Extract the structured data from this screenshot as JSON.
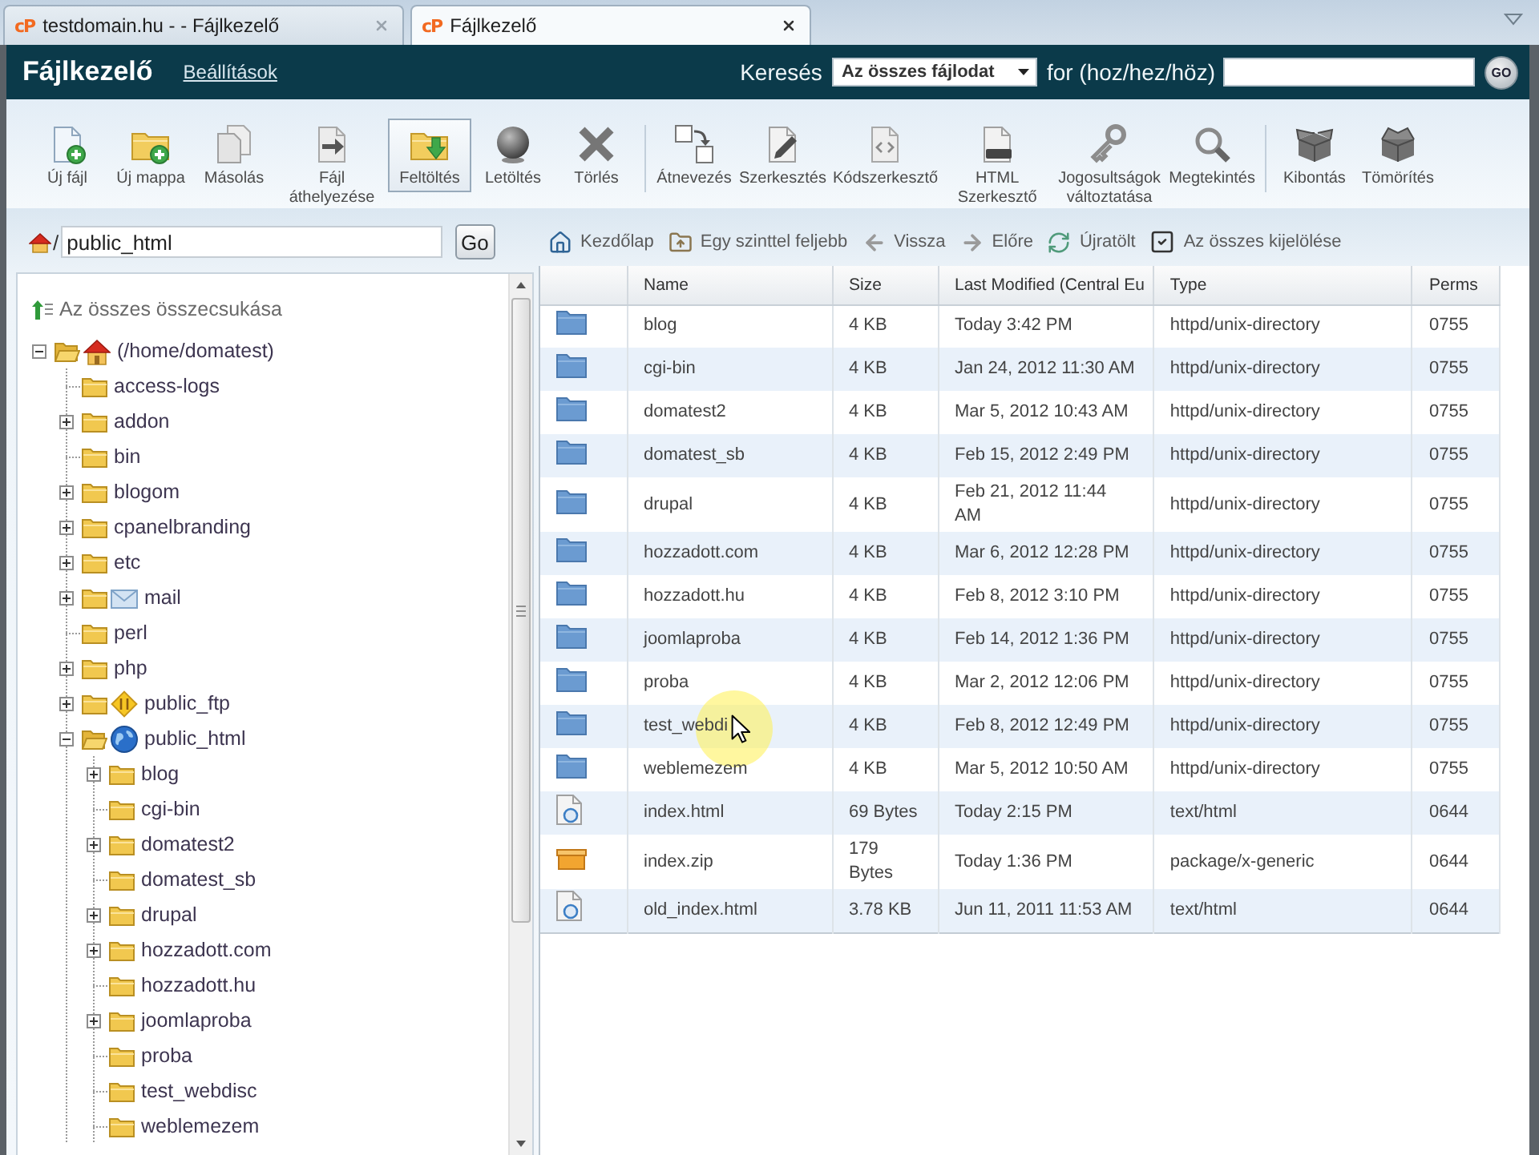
{
  "browser_tabs": [
    {
      "favicon": "cP",
      "title": "testdomain.hu - - Fájlkezelő",
      "selected": false
    },
    {
      "favicon": "cP",
      "title": "Fájlkezelő",
      "selected": true
    }
  ],
  "header": {
    "title": "Fájlkezelő",
    "settings_link": "Beállítások",
    "search_label": "Keresés",
    "search_scope": "Az összes fájlodat",
    "for_label": "for (hoz/hez/höz)",
    "go_button": "GO"
  },
  "toolbar": {
    "groups": [
      {
        "items": [
          {
            "kind": "new-file",
            "label": "Új fájl",
            "selected": false
          },
          {
            "kind": "new-folder",
            "label": "Új mappa",
            "selected": false
          },
          {
            "kind": "copy",
            "label": "Másolás",
            "selected": false
          },
          {
            "kind": "move",
            "label": "Fájl áthelyezése",
            "selected": false
          },
          {
            "kind": "upload",
            "label": "Feltöltés",
            "selected": true
          },
          {
            "kind": "download",
            "label": "Letöltés",
            "selected": false
          },
          {
            "kind": "delete",
            "label": "Törlés",
            "selected": false
          }
        ]
      },
      {
        "items": [
          {
            "kind": "rename",
            "label": "Átnevezés",
            "selected": false
          },
          {
            "kind": "edit",
            "label": "Szerkesztés",
            "selected": false
          },
          {
            "kind": "code-edit",
            "label": "Kódszerkesztő",
            "selected": false
          },
          {
            "kind": "html-edit",
            "label": "HTML Szerkesztő",
            "selected": false
          },
          {
            "kind": "permissions",
            "label": "Jogosultságok változtatása",
            "selected": false
          },
          {
            "kind": "view",
            "label": "Megtekintés",
            "selected": false
          }
        ]
      },
      {
        "items": [
          {
            "kind": "extract",
            "label": "Kibontás",
            "selected": false
          },
          {
            "kind": "compress",
            "label": "Tömörítés",
            "selected": false
          }
        ]
      }
    ]
  },
  "path_bar": {
    "prefix": "/",
    "value": "public_html",
    "button": "Go"
  },
  "tree": {
    "collapse_all": "Az összes összecsukása",
    "nodes": [
      {
        "label": "(/home/domatest)",
        "kind": "home",
        "leaf": false,
        "expanded": true,
        "children": [
          {
            "label": "access-logs",
            "kind": "folder",
            "leaf": true,
            "expanded": false
          },
          {
            "label": "addon",
            "kind": "folder",
            "leaf": false,
            "expanded": false
          },
          {
            "label": "bin",
            "kind": "folder",
            "leaf": true,
            "expanded": false
          },
          {
            "label": "blogom",
            "kind": "folder",
            "leaf": false,
            "expanded": false
          },
          {
            "label": "cpanelbranding",
            "kind": "folder",
            "leaf": false,
            "expanded": false
          },
          {
            "label": "etc",
            "kind": "folder",
            "leaf": false,
            "expanded": false
          },
          {
            "label": "mail",
            "kind": "mail",
            "leaf": false,
            "expanded": false
          },
          {
            "label": "perl",
            "kind": "folder",
            "leaf": true,
            "expanded": false
          },
          {
            "label": "php",
            "kind": "folder",
            "leaf": false,
            "expanded": false
          },
          {
            "label": "public_ftp",
            "kind": "ftp",
            "leaf": false,
            "expanded": false
          },
          {
            "label": "public_html",
            "kind": "globe",
            "leaf": false,
            "expanded": true,
            "children": [
              {
                "label": "blog",
                "kind": "folder",
                "leaf": false,
                "expanded": false
              },
              {
                "label": "cgi-bin",
                "kind": "folder",
                "leaf": true,
                "expanded": false
              },
              {
                "label": "domatest2",
                "kind": "folder",
                "leaf": false,
                "expanded": false
              },
              {
                "label": "domatest_sb",
                "kind": "folder",
                "leaf": true,
                "expanded": false
              },
              {
                "label": "drupal",
                "kind": "folder",
                "leaf": false,
                "expanded": false
              },
              {
                "label": "hozzadott.com",
                "kind": "folder",
                "leaf": false,
                "expanded": false
              },
              {
                "label": "hozzadott.hu",
                "kind": "folder",
                "leaf": true,
                "expanded": false
              },
              {
                "label": "joomlaproba",
                "kind": "folder",
                "leaf": false,
                "expanded": false
              },
              {
                "label": "proba",
                "kind": "folder",
                "leaf": true,
                "expanded": false
              },
              {
                "label": "test_webdisc",
                "kind": "folder",
                "leaf": true,
                "expanded": false
              },
              {
                "label": "weblemezem",
                "kind": "folder",
                "leaf": true,
                "expanded": false
              }
            ]
          }
        ]
      }
    ]
  },
  "nav_bar": {
    "items": [
      {
        "kind": "home",
        "label": "Kezdőlap"
      },
      {
        "kind": "up",
        "label": "Egy szinttel feljebb"
      },
      {
        "kind": "back",
        "label": "Vissza"
      },
      {
        "kind": "forward",
        "label": "Előre"
      },
      {
        "kind": "reload",
        "label": "Újratölt"
      },
      {
        "kind": "select-all",
        "label": "Az összes kijelölése"
      }
    ]
  },
  "table": {
    "columns": [
      "Name",
      "Size",
      "Last Modified (Central Eu",
      "Type",
      "Perms"
    ],
    "rows": [
      {
        "kind": "folder",
        "name": "blog",
        "size": "4 KB",
        "modified": "Today 3:42 PM",
        "type": "httpd/unix-directory",
        "perms": "0755",
        "hovered": false
      },
      {
        "kind": "folder",
        "name": "cgi-bin",
        "size": "4 KB",
        "modified": "Jan 24, 2012 11:30 AM",
        "type": "httpd/unix-directory",
        "perms": "0755",
        "hovered": false
      },
      {
        "kind": "folder",
        "name": "domatest2",
        "size": "4 KB",
        "modified": "Mar 5, 2012 10:43 AM",
        "type": "httpd/unix-directory",
        "perms": "0755",
        "hovered": false
      },
      {
        "kind": "folder",
        "name": "domatest_sb",
        "size": "4 KB",
        "modified": "Feb 15, 2012 2:49 PM",
        "type": "httpd/unix-directory",
        "perms": "0755",
        "hovered": false
      },
      {
        "kind": "folder",
        "name": "drupal",
        "size": "4 KB",
        "modified": "Feb 21, 2012 11:44 AM",
        "type": "httpd/unix-directory",
        "perms": "0755",
        "hovered": false
      },
      {
        "kind": "folder",
        "name": "hozzadott.com",
        "size": "4 KB",
        "modified": "Mar 6, 2012 12:28 PM",
        "type": "httpd/unix-directory",
        "perms": "0755",
        "hovered": false
      },
      {
        "kind": "folder",
        "name": "hozzadott.hu",
        "size": "4 KB",
        "modified": "Feb 8, 2012 3:10 PM",
        "type": "httpd/unix-directory",
        "perms": "0755",
        "hovered": false
      },
      {
        "kind": "folder",
        "name": "joomlaproba",
        "size": "4 KB",
        "modified": "Feb 14, 2012 1:36 PM",
        "type": "httpd/unix-directory",
        "perms": "0755",
        "hovered": false
      },
      {
        "kind": "folder",
        "name": "proba",
        "size": "4 KB",
        "modified": "Mar 2, 2012 12:06 PM",
        "type": "httpd/unix-directory",
        "perms": "0755",
        "hovered": false
      },
      {
        "kind": "folder",
        "name": "test_webdi",
        "size": "4 KB",
        "modified": "Feb 8, 2012 12:49 PM",
        "type": "httpd/unix-directory",
        "perms": "0755",
        "hovered": true
      },
      {
        "kind": "folder",
        "name": "weblemezem",
        "size": "4 KB",
        "modified": "Mar 5, 2012 10:50 AM",
        "type": "httpd/unix-directory",
        "perms": "0755",
        "hovered": false
      },
      {
        "kind": "html",
        "name": "index.html",
        "size": "69 Bytes",
        "modified": "Today 2:15 PM",
        "type": "text/html",
        "perms": "0644",
        "hovered": false
      },
      {
        "kind": "zip",
        "name": "index.zip",
        "size": "179 Bytes",
        "modified": "Today 1:36 PM",
        "type": "package/x-generic",
        "perms": "0644",
        "hovered": false
      },
      {
        "kind": "html",
        "name": "old_index.html",
        "size": "3.78 KB",
        "modified": "Jun 11, 2011 11:53 AM",
        "type": "text/html",
        "perms": "0644",
        "hovered": false
      }
    ]
  }
}
